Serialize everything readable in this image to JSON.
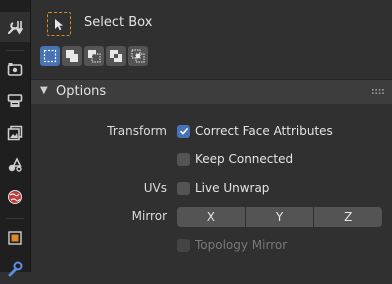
{
  "sidebar": {
    "tabs": [
      {
        "icon": "tool-icon",
        "active": true
      },
      {
        "icon": "render-icon"
      },
      {
        "icon": "output-icon"
      },
      {
        "icon": "view-layer-icon"
      },
      {
        "icon": "scene-icon"
      },
      {
        "icon": "world-icon"
      },
      {
        "icon": "object-icon"
      },
      {
        "icon": "modifier-icon"
      }
    ]
  },
  "tool": {
    "name": "Select Box",
    "icon": "select-box-icon"
  },
  "selection_modes": [
    {
      "icon": "mode-new-icon",
      "active": true
    },
    {
      "icon": "mode-extend-icon"
    },
    {
      "icon": "mode-subtract-icon"
    },
    {
      "icon": "mode-invert-icon"
    },
    {
      "icon": "mode-intersect-icon"
    }
  ],
  "options": {
    "title": "Options",
    "transform_label": "Transform",
    "correct_face_attributes": {
      "label": "Correct Face Attributes",
      "checked": true
    },
    "keep_connected": {
      "label": "Keep Connected",
      "checked": false
    },
    "uvs_label": "UVs",
    "live_unwrap": {
      "label": "Live Unwrap",
      "checked": false
    },
    "mirror_label": "Mirror",
    "mirror_axes": [
      "X",
      "Y",
      "Z"
    ],
    "topology_mirror": {
      "label": "Topology Mirror",
      "checked": false,
      "disabled": true
    }
  },
  "colors": {
    "accent": "#4772b3",
    "tool_outline": "#e08a22",
    "panel_bg": "#303030",
    "sidebar_bg": "#1f1f1f"
  }
}
